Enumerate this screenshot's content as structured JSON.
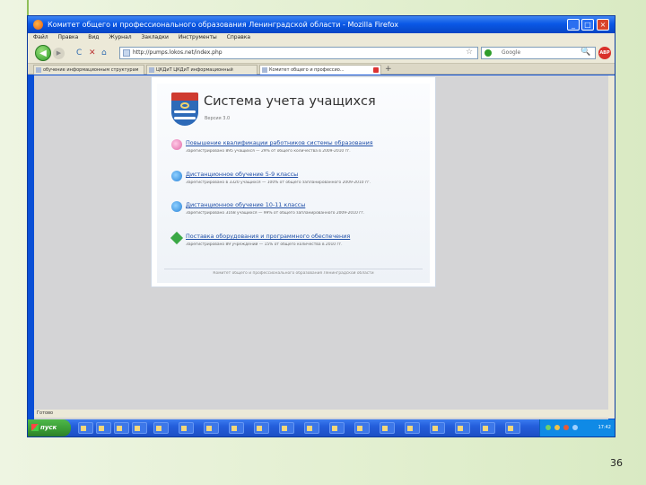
{
  "window": {
    "title": "Комитет общего и профессионального образования Ленинградской области - Mozilla Firefox",
    "minimize": "_",
    "maximize": "□",
    "close": "×"
  },
  "menu": [
    "Файл",
    "Правка",
    "Вид",
    "Журнал",
    "Закладки",
    "Инструменты",
    "Справка"
  ],
  "nav": {
    "back": "◀",
    "forward": "▶",
    "reload": "C",
    "stop": "✕",
    "home": "⌂",
    "url": "http://pumps.lokos.net/index.php",
    "star": "☆",
    "search_placeholder": "Google",
    "search_icon": "🔍",
    "abp": "ABP"
  },
  "tabs": [
    {
      "label": "обучение информационным структурам"
    },
    {
      "label": "ЦКДиТ ЦКДиТ информационный"
    },
    {
      "label": "Комитет общего и профессио...",
      "active": true
    }
  ],
  "tab_new": "+",
  "webpage": {
    "title": "Система учета учащихся",
    "version": "Версия 3.0",
    "entries": [
      {
        "link": "Повышение квалификации работников системы образования",
        "desc": "Зарегистрировано 895 учащихся — 29% от общего количества в 2009-2010 гг."
      },
      {
        "link": "Дистанционное обучение 5-9 классы",
        "desc": "Зарегистрировано в 3320 учащихся — 100% от общего запланированного 2009-2010 гг."
      },
      {
        "link": "Дистанционное обучение 10-11 классы",
        "desc": "Зарегистрировано 3168 учащихся — 99% от общего запланированного 2009-2010 гг."
      },
      {
        "link": "Поставка оборудования и программного обеспечения",
        "desc": "Зарегистрировано 89 учреждений — 15% от общего количества в 2010 гг."
      }
    ],
    "footer": "Комитет общего и профессионального образования Ленинградской области"
  },
  "status": "Готово",
  "taskbar": {
    "start": "пуск",
    "clock": "17:42"
  },
  "slide": {
    "number": "36"
  }
}
